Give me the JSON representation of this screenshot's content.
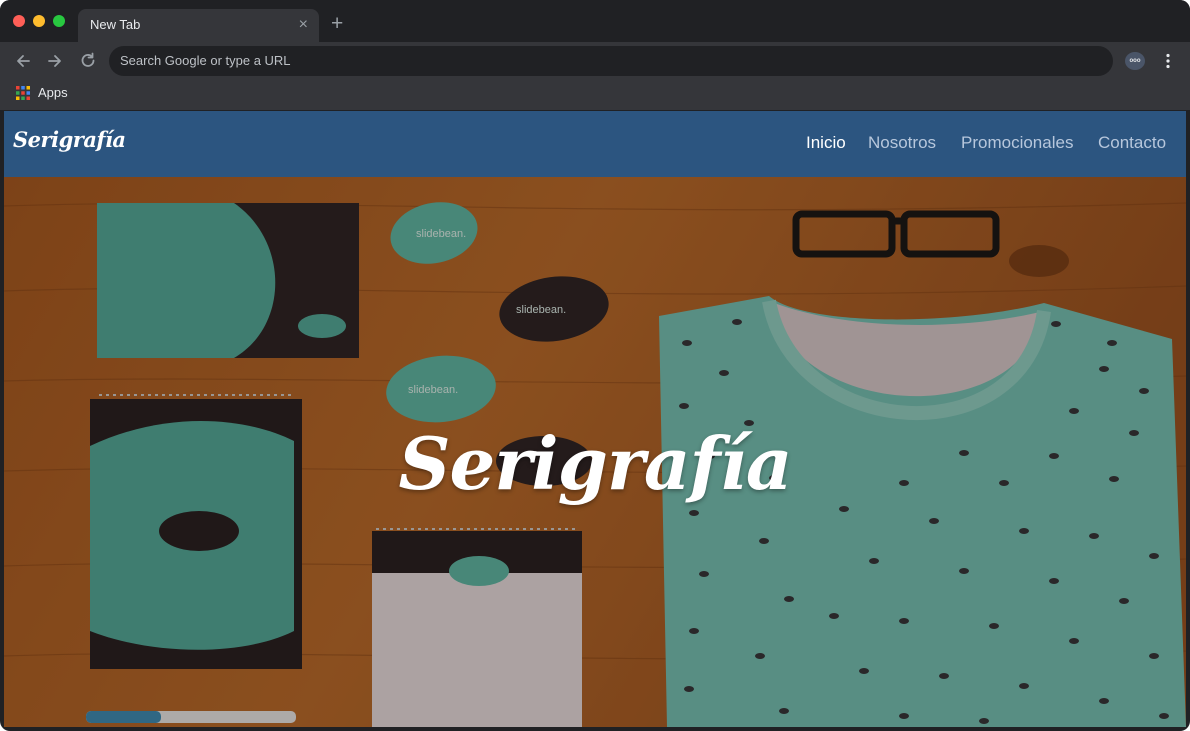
{
  "browser": {
    "tab_title": "New Tab",
    "tab_close_glyph": "×",
    "new_tab_glyph": "+",
    "omnibox_placeholder": "Search Google or type a URL",
    "bookmarks": [
      {
        "label": "Apps",
        "icon": "apps-grid-icon"
      }
    ],
    "extension_label": "ooo"
  },
  "site": {
    "logo": "Serigrafía",
    "nav": [
      "Inicio",
      "Nosotros",
      "Promocionales",
      "Contacto"
    ],
    "hero_title": "Serigrafía",
    "nav_color": "#2c5580"
  },
  "mockup_text": {
    "brand": "slidebean."
  }
}
